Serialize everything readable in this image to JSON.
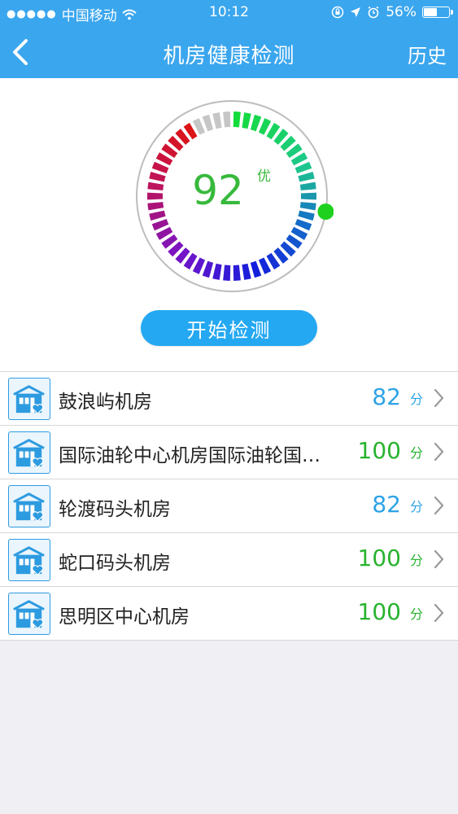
{
  "status_bar": {
    "carrier": "中国移动",
    "time": "10:12",
    "battery": "56%",
    "battery_level": 0.56
  },
  "nav": {
    "title": "机房健康检测",
    "history_label": "历史"
  },
  "gauge": {
    "score": "92",
    "grade": "优",
    "level": 0.92
  },
  "start_button": "开始检测",
  "rooms": [
    {
      "name": "鼓浪屿机房",
      "score": "82",
      "unit": "分",
      "color": "#2ea3e6"
    },
    {
      "name": "国际油轮中心机房国际油轮国…",
      "score": "100",
      "unit": "分",
      "color": "#28b32f"
    },
    {
      "name": "轮渡码头机房",
      "score": "82",
      "unit": "分",
      "color": "#2ea3e6"
    },
    {
      "name": "蛇口码头机房",
      "score": "100",
      "unit": "分",
      "color": "#28b32f"
    },
    {
      "name": "思明区中心机房",
      "score": "100",
      "unit": "分",
      "color": "#28b32f"
    }
  ]
}
